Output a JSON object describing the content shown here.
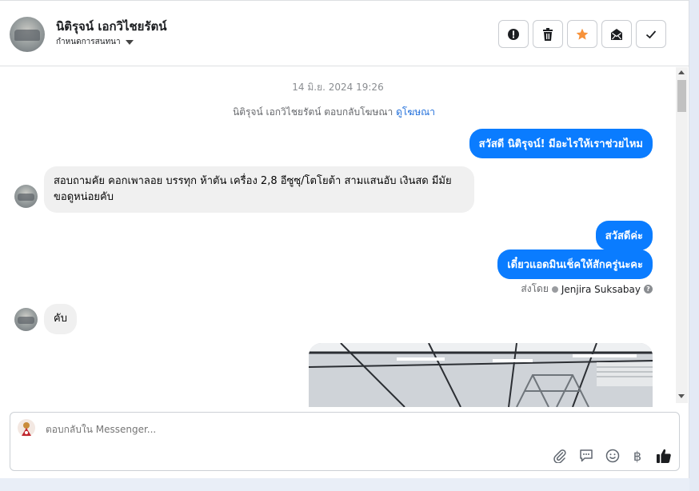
{
  "header": {
    "name": "นิติรุจน์ เอกวิไชยรัตน์",
    "subtitle": "กำหนดการสนทนา",
    "buttons": [
      {
        "icon": "alert-icon"
      },
      {
        "icon": "trash-icon"
      },
      {
        "icon": "star-icon",
        "color": "#f7923a"
      },
      {
        "icon": "mark-unread-icon"
      },
      {
        "icon": "check-icon"
      }
    ]
  },
  "conversation": {
    "timestamp": "14 มิ.ย. 2024 19:26",
    "ad_reply_text": "นิติรุจน์ เอกวิไชยรัตน์ ตอบกลับโฆษณา",
    "ad_reply_link": "ดูโฆษณา",
    "messages": [
      {
        "side": "out",
        "text": "สวัสดี นิติรุจน์! มีอะไรให้เราช่วยไหม"
      },
      {
        "side": "in",
        "text": "สอบถามคัย คอกเพาลอย บรรทุก ห้าตัน เครื่อง 2,8 อีซูซุ/โตโยต้า สามแสนอับ เงินสด มีมัยขอดูหน่อยคับ"
      },
      {
        "side": "out",
        "text": "สวัสดีค่ะ"
      },
      {
        "side": "out",
        "text": "เดี๋ยวแอดมินเช็คให้สักครู่นะคะ"
      },
      {
        "side": "in",
        "text": "คับ"
      }
    ],
    "sent_by_label": "ส่งโดย",
    "sent_by_name": "Jenjira Suksabay"
  },
  "composer": {
    "placeholder": "ตอบกลับใน Messenger...",
    "icons": [
      "attachment-icon",
      "saved-reply-icon",
      "emoji-icon",
      "baht-icon",
      "thumbs-up-icon"
    ],
    "baht_symbol": "฿"
  },
  "colors": {
    "accent": "#0a7cff",
    "star": "#f7923a"
  }
}
